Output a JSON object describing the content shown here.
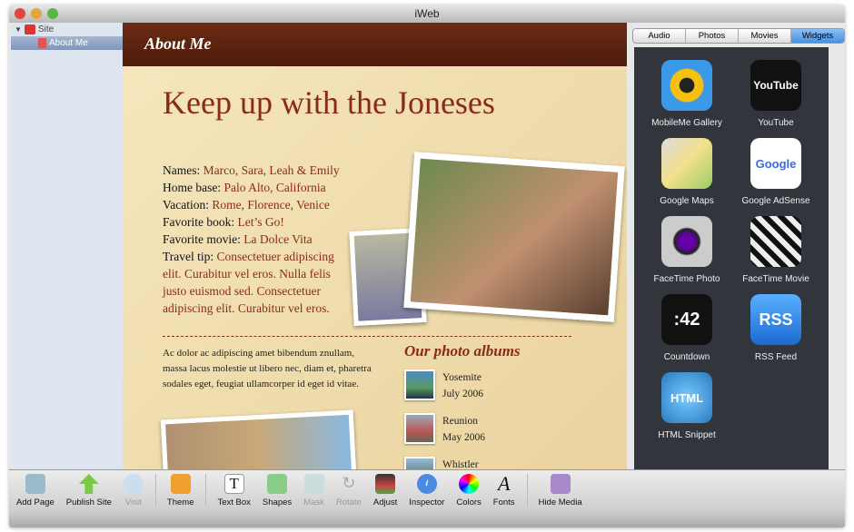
{
  "window": {
    "title": "iWeb"
  },
  "sidebar": {
    "site": "Site",
    "page": "About Me"
  },
  "page": {
    "banner": "About Me",
    "headline": "Keep up with the Joneses",
    "facts": [
      {
        "label": "Names: ",
        "value": "Marco, Sara, Leah & Emily"
      },
      {
        "label": "Home base: ",
        "value": "Palo Alto, California"
      },
      {
        "label": "Vacation: ",
        "value": "Rome, Florence, Venice"
      },
      {
        "label": "Favorite book: ",
        "value": "Let’s Go!"
      },
      {
        "label": "Favorite movie: ",
        "value": "La Dolce Vita"
      },
      {
        "label": "Travel tip: ",
        "value": "Consectetuer adipiscing elit. Curabitur vel eros. Nulla felis justo euismod sed. Consectetuer adipiscing elit. Curabitur vel eros."
      }
    ],
    "body": "Ac dolor ac adipiscing amet bibendum znullam, massa lacus molestie ut libero nec, diam et, pharetra sodales eget, feugiat ullamcorper id eget id vitae.",
    "albums_heading": "Our photo albums",
    "albums": [
      {
        "name": "Yosemite",
        "date": "July 2006"
      },
      {
        "name": "Reunion",
        "date": "May 2006"
      },
      {
        "name": "Whistler",
        "date": ""
      }
    ]
  },
  "toolbar": [
    "Add Page",
    "Publish Site",
    "Visit",
    "Theme",
    "Text Box",
    "Shapes",
    "Mask",
    "Rotate",
    "Adjust",
    "Inspector",
    "Colors",
    "Fonts",
    "Hide Media"
  ],
  "media": {
    "tabs": [
      "Audio",
      "Photos",
      "Movies",
      "Widgets"
    ],
    "active_tab": "Widgets",
    "widgets": [
      "MobileMe Gallery",
      "YouTube",
      "Google Maps",
      "Google AdSense",
      "FaceTime Photo",
      "FaceTime Movie",
      "Countdown",
      "RSS Feed",
      "HTML Snippet"
    ],
    "countdown_text": ":42",
    "rss_text": "RSS",
    "html_text": "HTML",
    "youtube_text": "YouTube",
    "adsense_text": "Google"
  }
}
